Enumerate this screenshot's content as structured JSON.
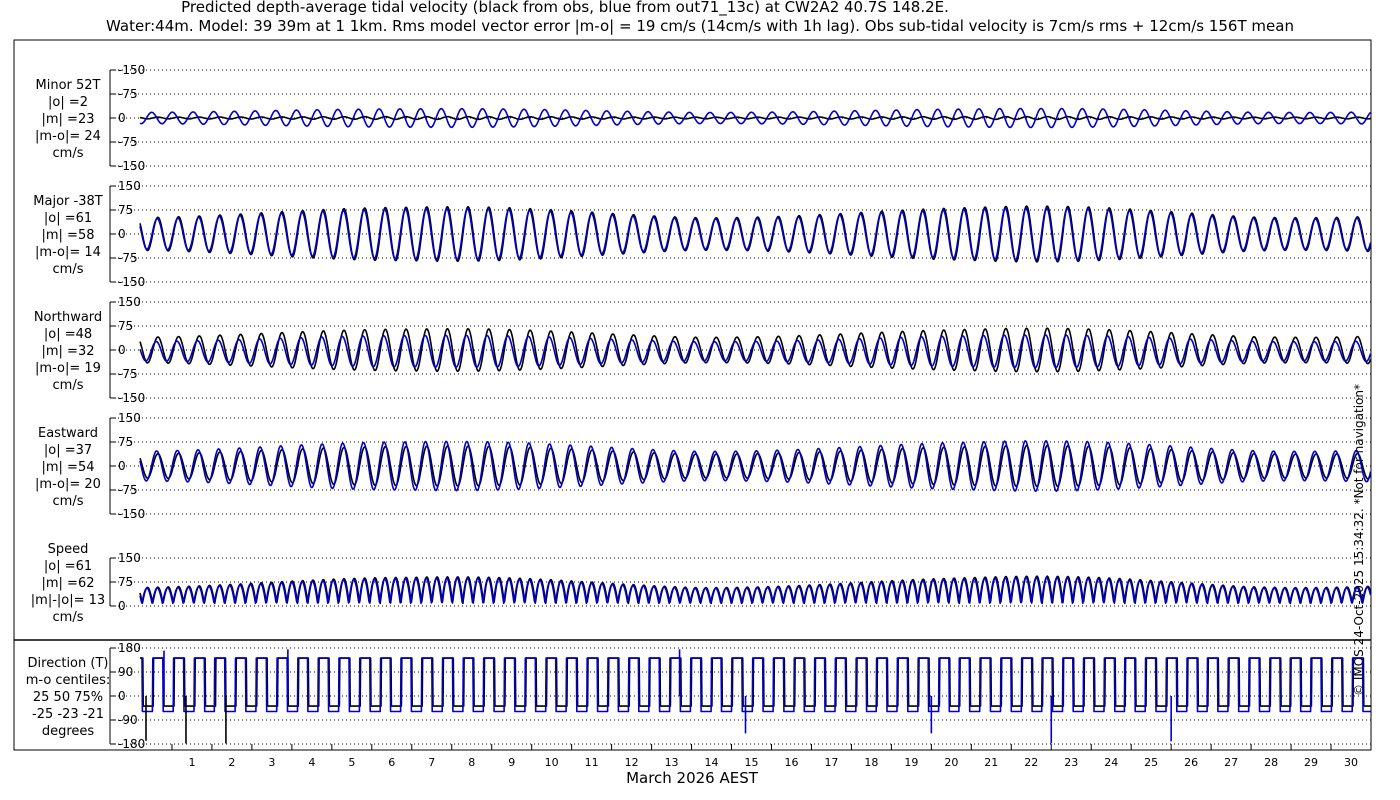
{
  "header": {
    "title_line1": "Predicted depth-average tidal velocity (black from obs, blue from out71_13c) at CW2A2 40.7S 148.2E.",
    "title_line2": "Water:44m. Model: 39 39m at 1 1km. Rms model vector error |m-o| = 19 cm/s (14cm/s with 1h lag). Obs sub-tidal velocity is 7cm/s rms + 12cm/s 156T mean"
  },
  "credit": "© IMOS 24-Oct-2025 15:34:32. *Not for navigation*",
  "colors": {
    "obs": "#000000",
    "model": "#0000cc",
    "grid": "#000000",
    "background": "#ffffff"
  },
  "chart_data": {
    "type": "line",
    "xlabel": "March 2026 AEST",
    "x_ticks": [
      "1",
      "2",
      "3",
      "4",
      "5",
      "6",
      "7",
      "8",
      "9",
      "10",
      "11",
      "12",
      "13",
      "14",
      "15",
      "16",
      "17",
      "18",
      "19",
      "20",
      "21",
      "22",
      "23",
      "24",
      "25",
      "26",
      "27",
      "28",
      "29",
      "30"
    ],
    "xlim_days": [
      0.2,
      31.0
    ],
    "tide_period_hours": 12.42,
    "spring_neap_modulation": {
      "neap_day": 14.5,
      "strong_day": 24.5
    },
    "series_styles": {
      "obs": "black",
      "model": "blue"
    },
    "panels": [
      {
        "id": "minor",
        "label_lines": [
          "Minor 52T",
          "|o| =2",
          "|m| =23",
          "|m-o|= 24",
          "cm/s"
        ],
        "yticks": [
          "-150",
          "-75",
          "0",
          "-75",
          "-150"
        ],
        "ylim": [
          -150,
          150
        ],
        "obs_amp": 4,
        "model_amp": 28,
        "model_phase_offset": 0.3,
        "model_mean": 0
      },
      {
        "id": "major",
        "label_lines": [
          "Major -38T",
          "|o| =61",
          "|m| =58",
          "|m-o|= 14",
          "cm/s"
        ],
        "yticks": [
          "150",
          "75",
          "0",
          "-75",
          "-150"
        ],
        "ylim": [
          -150,
          150
        ],
        "obs_amp": 82,
        "model_amp": 76,
        "model_phase_offset": 0.03,
        "model_mean": 0
      },
      {
        "id": "northward",
        "label_lines": [
          "Northward",
          "|o| =48",
          "|m| =32",
          "|m-o|= 19",
          "cm/s"
        ],
        "yticks": [
          "150",
          "75",
          "0",
          "-75",
          "-150"
        ],
        "ylim": [
          -150,
          150
        ],
        "obs_amp": 64,
        "model_amp": 48,
        "model_phase_offset": 0.08,
        "model_mean": -4
      },
      {
        "id": "eastward",
        "label_lines": [
          "Eastward",
          "|o| =37",
          "|m| =54",
          "|m-o|= 20",
          "cm/s"
        ],
        "yticks": [
          "150",
          "75",
          "0",
          "-75",
          "-150"
        ],
        "ylim": [
          -150,
          150
        ],
        "obs_amp": 60,
        "model_amp": 74,
        "model_phase_offset": 0.06,
        "model_mean": 0
      },
      {
        "id": "speed",
        "label_lines": [
          "Speed",
          "|o| =61",
          "|m| =62",
          "|m|-|o|= 13",
          "cm/s"
        ],
        "yticks": [
          "150",
          "75",
          "0"
        ],
        "ylim": [
          0,
          150
        ],
        "obs_amp": 80,
        "model_amp": 76,
        "model_phase_offset": 0.03,
        "model_mean": 0
      },
      {
        "id": "direction",
        "label_lines": [
          "Direction (T)",
          "m-o centiles:",
          "25  50  75%",
          "-25 -23 -21",
          "degrees"
        ],
        "yticks": [
          "180",
          "90",
          "0",
          "-90",
          "-180"
        ],
        "ylim": [
          -180,
          180
        ],
        "obs_levels": [
          142,
          -38
        ],
        "model_levels": [
          142,
          -58
        ],
        "spikes": [
          {
            "day": 0.35,
            "value": -168,
            "series": "obs"
          },
          {
            "day": 0.8,
            "value": 170,
            "series": "model"
          },
          {
            "day": 1.35,
            "value": -178,
            "series": "obs"
          },
          {
            "day": 2.35,
            "value": -178,
            "series": "obs"
          },
          {
            "day": 3.9,
            "value": 175,
            "series": "model"
          },
          {
            "day": 13.7,
            "value": 175,
            "series": "model"
          },
          {
            "day": 15.35,
            "value": -140,
            "series": "model"
          },
          {
            "day": 20.0,
            "value": -140,
            "series": "model"
          },
          {
            "day": 23.0,
            "value": -178,
            "series": "model"
          },
          {
            "day": 26.0,
            "value": -170,
            "series": "model"
          }
        ]
      }
    ]
  }
}
